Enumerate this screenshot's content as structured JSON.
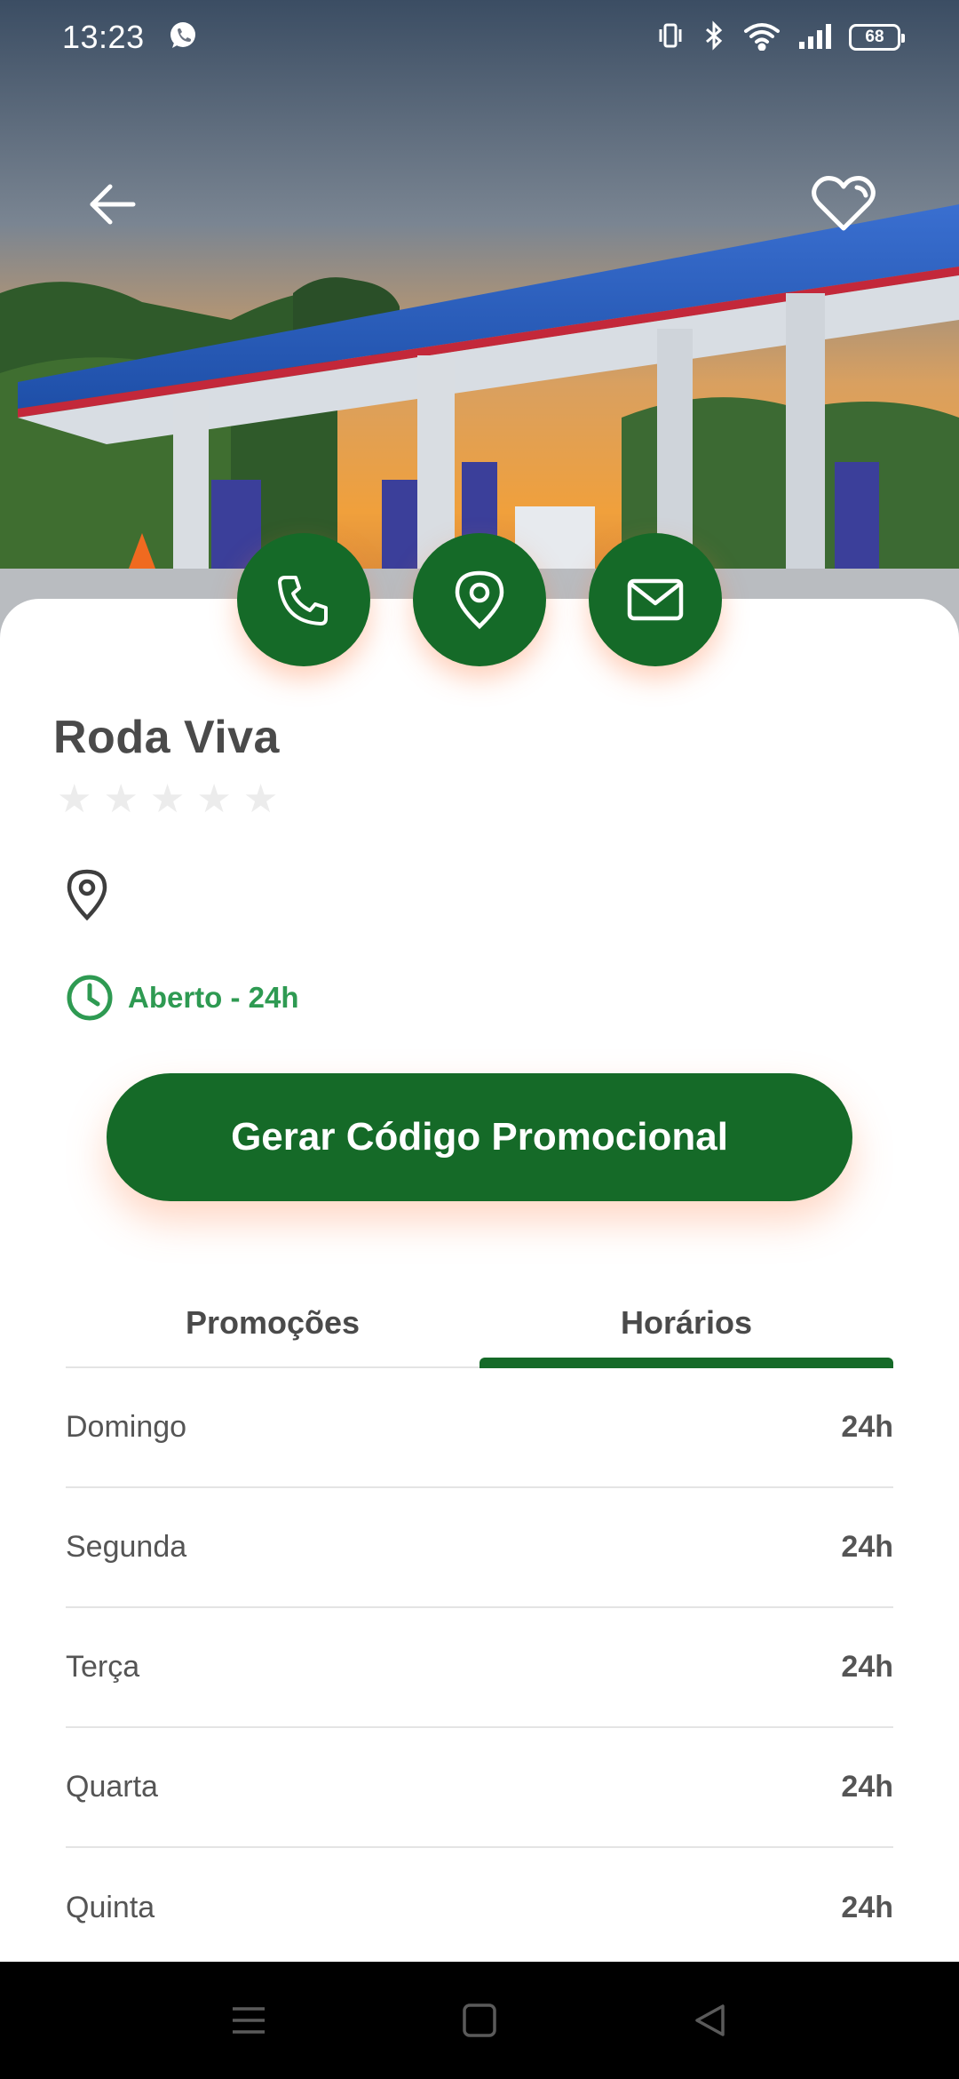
{
  "status_bar": {
    "time": "13:23",
    "battery": "68",
    "icons": [
      "whatsapp-icon",
      "vibrate-icon",
      "bluetooth-icon",
      "wifi-icon",
      "signal-icon",
      "battery-icon"
    ]
  },
  "header": {
    "back_icon": "arrow-left-icon",
    "favorite_icon": "heart-icon"
  },
  "actions": {
    "items": [
      {
        "icon": "phone-icon"
      },
      {
        "icon": "map-pin-icon"
      },
      {
        "icon": "mail-icon"
      }
    ]
  },
  "station": {
    "name": "Roda Viva",
    "rating": 0,
    "rating_max": 5,
    "address": "",
    "status": "Aberto - 24h"
  },
  "promo_button": {
    "label": "Gerar Código Promocional"
  },
  "tabs": {
    "items": [
      {
        "label": "Promoções",
        "active": false
      },
      {
        "label": "Horários",
        "active": true
      }
    ]
  },
  "schedule": [
    {
      "day": "Domingo",
      "hours": "24h"
    },
    {
      "day": "Segunda",
      "hours": "24h"
    },
    {
      "day": "Terça",
      "hours": "24h"
    },
    {
      "day": "Quarta",
      "hours": "24h"
    },
    {
      "day": "Quinta",
      "hours": "24h"
    }
  ],
  "colors": {
    "primary": "#156a28",
    "accent_text": "#2e9a52",
    "text": "#4a4a4a",
    "divider": "#e4e4e4"
  },
  "nav_bar": {
    "icons": [
      "menu-icon",
      "home-square-icon",
      "back-triangle-icon"
    ]
  }
}
